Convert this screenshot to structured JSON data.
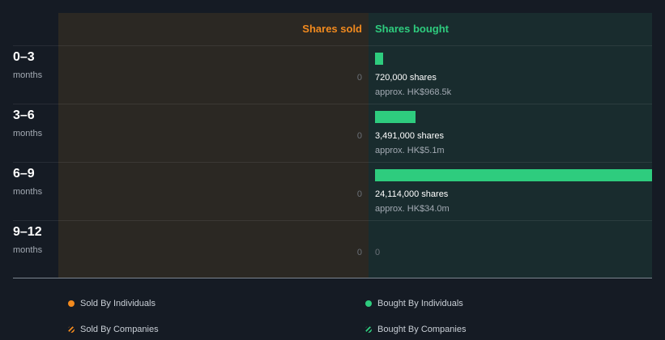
{
  "chart_data": {
    "type": "bar",
    "orientation": "horizontal",
    "categories": [
      {
        "period": "0–3",
        "unit": "months"
      },
      {
        "period": "3–6",
        "unit": "months"
      },
      {
        "period": "6–9",
        "unit": "months"
      },
      {
        "period": "9–12",
        "unit": "months"
      }
    ],
    "series": [
      {
        "name": "Shares sold",
        "values": [
          0,
          0,
          0,
          0
        ],
        "labels": [
          "0",
          "0",
          "0",
          "0"
        ],
        "color": "#f28a1e"
      },
      {
        "name": "Shares bought",
        "values": [
          720000,
          3491000,
          24114000,
          0
        ],
        "share_labels": [
          "720,000 shares",
          "3,491,000 shares",
          "24,114,000 shares",
          "0"
        ],
        "approx_labels": [
          "approx. HK$968.5k",
          "approx. HK$5.1m",
          "approx. HK$34.0m",
          ""
        ],
        "color": "#2ecc7e"
      }
    ],
    "xlim": [
      0,
      24114000
    ],
    "legend": {
      "placement": "bottom",
      "items": [
        {
          "label": "Sold By Individuals",
          "color": "#f28a1e",
          "style": "solid"
        },
        {
          "label": "Bought By Individuals",
          "color": "#2ecc7e",
          "style": "solid"
        },
        {
          "label": "Sold By Companies",
          "color": "#f28a1e",
          "style": "hatched"
        },
        {
          "label": "Bought By Companies",
          "color": "#2ecc7e",
          "style": "hatched"
        }
      ]
    }
  }
}
